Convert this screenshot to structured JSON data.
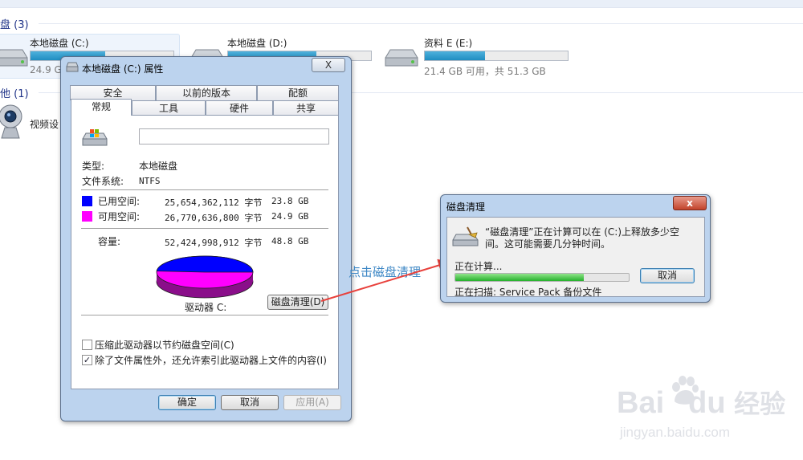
{
  "explorer": {
    "hard_disks_header": "盘 (3)",
    "other_header": "他 (1)",
    "drives": [
      {
        "name": "本地磁盘 (C:)",
        "used_fraction": 0.52,
        "caption": "24.9 G"
      },
      {
        "name": "本地磁盘 (D:)",
        "used_fraction": 0.62,
        "caption": ""
      },
      {
        "name": "资料 E (E:)",
        "used_fraction": 0.42,
        "caption": "21.4 GB 可用，共 51.3 GB"
      }
    ],
    "other_device": "视频设"
  },
  "properties_window": {
    "title": "本地磁盘 (C:) 属性",
    "close_label": "X",
    "tabs_back": [
      "安全",
      "以前的版本",
      "配额"
    ],
    "tabs_front": [
      "常规",
      "工具",
      "硬件",
      "共享"
    ],
    "active_tab": "常规",
    "name_value": "",
    "type_label": "类型:",
    "type_value": "本地磁盘",
    "fs_label": "文件系统:",
    "fs_value": "NTFS",
    "used_label": "已用空间:",
    "used_bytes": "25,654,362,112 字节",
    "used_size": "23.8 GB",
    "free_label": "可用空间:",
    "free_bytes": "26,770,636,800 字节",
    "free_size": "24.9 GB",
    "capacity_label": "容量:",
    "capacity_bytes": "52,424,998,912 字节",
    "capacity_size": "48.8 GB",
    "drive_label": "驱动器 C:",
    "cleanup_button": "磁盘清理(D)",
    "compress_label": "压缩此驱动器以节约磁盘空间(C)",
    "compress_checked": false,
    "index_label": "除了文件属性外，还允许索引此驱动器上文件的内容(I)",
    "index_checked": true,
    "check_mark": "✓",
    "ok": "确定",
    "cancel": "取消",
    "apply": "应用(A)",
    "used_fraction": 0.489
  },
  "cleanup_dialog": {
    "title": "磁盘清理",
    "close_label": "x",
    "message_line1": "“磁盘清理”正在计算可以在 (C:)上释放多少空",
    "message_line2": "间。这可能需要几分钟时间。",
    "calculating": "正在计算...",
    "progress_fraction": 0.74,
    "cancel": "取消",
    "scanning": "正在扫描:  Service Pack 备份文件"
  },
  "annotation": "点击磁盘清理",
  "watermark": {
    "brand": "Bai",
    "brand2": "du",
    "cn": "经验",
    "url": "jingyan.baidu.com"
  },
  "colors": {
    "used": "#0000ff",
    "free": "#ff00ff",
    "arrow": "#e8413c",
    "annotation": "#3d87c5",
    "progress": "#25b02b"
  }
}
